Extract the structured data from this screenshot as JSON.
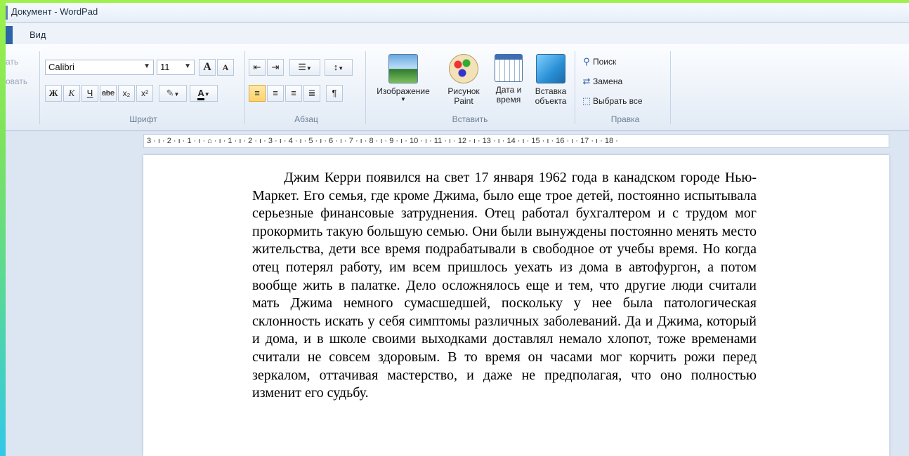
{
  "titlebar": {
    "title": "Документ - WordPad"
  },
  "ribbon_tabs": {
    "view": "Вид"
  },
  "clipboard_partial": {
    "item1": "ать",
    "item2": "овать"
  },
  "font_group": {
    "font_name": "Calibri",
    "font_size": "11",
    "grow_label": "A",
    "shrink_label": "A",
    "bold": "Ж",
    "italic": "К",
    "underline": "Ч",
    "strike": "abe",
    "subscript": "x₂",
    "superscript": "x²",
    "color_letter": "A",
    "label": "Шрифт"
  },
  "paragraph_group": {
    "label": "Абзац"
  },
  "insert_group": {
    "image": "Изображение",
    "paint_line1": "Рисунок",
    "paint_line2": "Paint",
    "datetime_line1": "Дата и",
    "datetime_line2": "время",
    "object_line1": "Вставка",
    "object_line2": "объекта",
    "label": "Вставить"
  },
  "edit_group": {
    "find": "Поиск",
    "replace": "Замена",
    "select_all": "Выбрать все",
    "label": "Правка"
  },
  "ruler": {
    "text": "3 · ı · 2 · ı · 1 · ı · ⌂ · ı · 1 · ı · 2 · ı · 3 · ı · 4 · ı · 5 · ı · 6 · ı · 7 · ı · 8 · ı · 9 · ı · 10 · ı · 11 · ı · 12 · ı · 13 · ı · 14 · ı · 15 · ı · 16 · ı · 17 · ı · 18 ·"
  },
  "document": {
    "text": "Джим Керри появился на свет 17 января 1962 года в канадском городе Нью-Маркет. Его семья, где кроме Джима, было еще трое детей, постоянно испытывала серьезные финансовые затруднения. Отец работал бухгалтером и с трудом мог прокормить такую большую семью. Они были вынуждены постоянно менять место жительства, дети все время подрабатывали в свободное от учебы время. Но когда отец потерял работу, им всем пришлось уехать из дома в автофургон, а потом вообще жить в палатке. Дело осложнялось еще и тем, что другие люди считали мать Джима немного сумасшедшей, поскольку у нее была патологическая склонность искать у себя симптомы различных заболеваний. Да и Джима, который и дома, и в школе своими выходками доставлял немало хлопот, тоже временами считали не совсем здоровым. В то время он часами мог корчить рожи перед зеркалом, оттачивая мастерство, и даже не предполагая, что оно полностью изменит его судьбу."
  },
  "colors": {
    "accent": "#2e63a8",
    "ribbon_bg": "#eef3fa",
    "active_align": "#ffd36a"
  }
}
